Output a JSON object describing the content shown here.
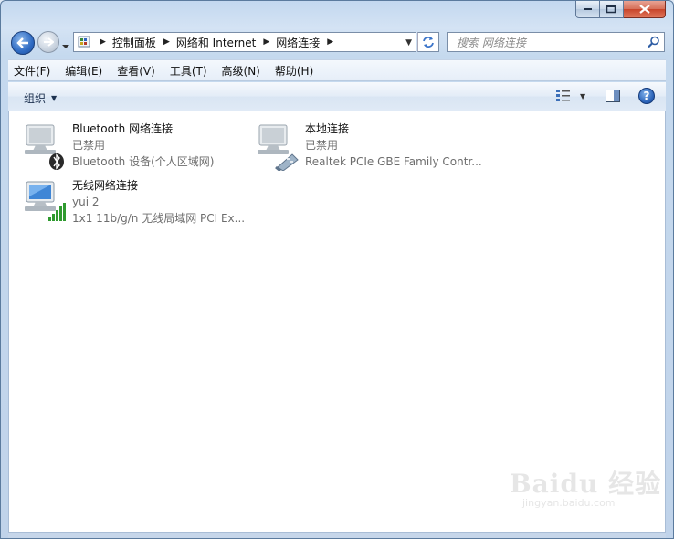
{
  "address_bar": {
    "crumbs": [
      "控制面板",
      "网络和 Internet",
      "网络连接"
    ]
  },
  "search": {
    "placeholder": "搜索 网络连接"
  },
  "menu": [
    "文件(F)",
    "编辑(E)",
    "查看(V)",
    "工具(T)",
    "高级(N)",
    "帮助(H)"
  ],
  "command_bar": {
    "organize_label": "组织",
    "help_label": "?"
  },
  "connections": [
    {
      "name": "Bluetooth 网络连接",
      "status": "已禁用",
      "device": "Bluetooth 设备(个人区域网)",
      "icon": "bluetooth-connection-icon"
    },
    {
      "name": "本地连接",
      "status": "已禁用",
      "device": "Realtek PCIe GBE Family Contr...",
      "icon": "ethernet-connection-icon"
    },
    {
      "name": "无线网络连接",
      "status": "yui  2",
      "device": "1x1 11b/g/n 无线局域网 PCI Ex...",
      "icon": "wireless-connection-icon"
    }
  ],
  "watermark": {
    "brand": "Baidu 经验",
    "url": "jingyan.baidu.com"
  }
}
